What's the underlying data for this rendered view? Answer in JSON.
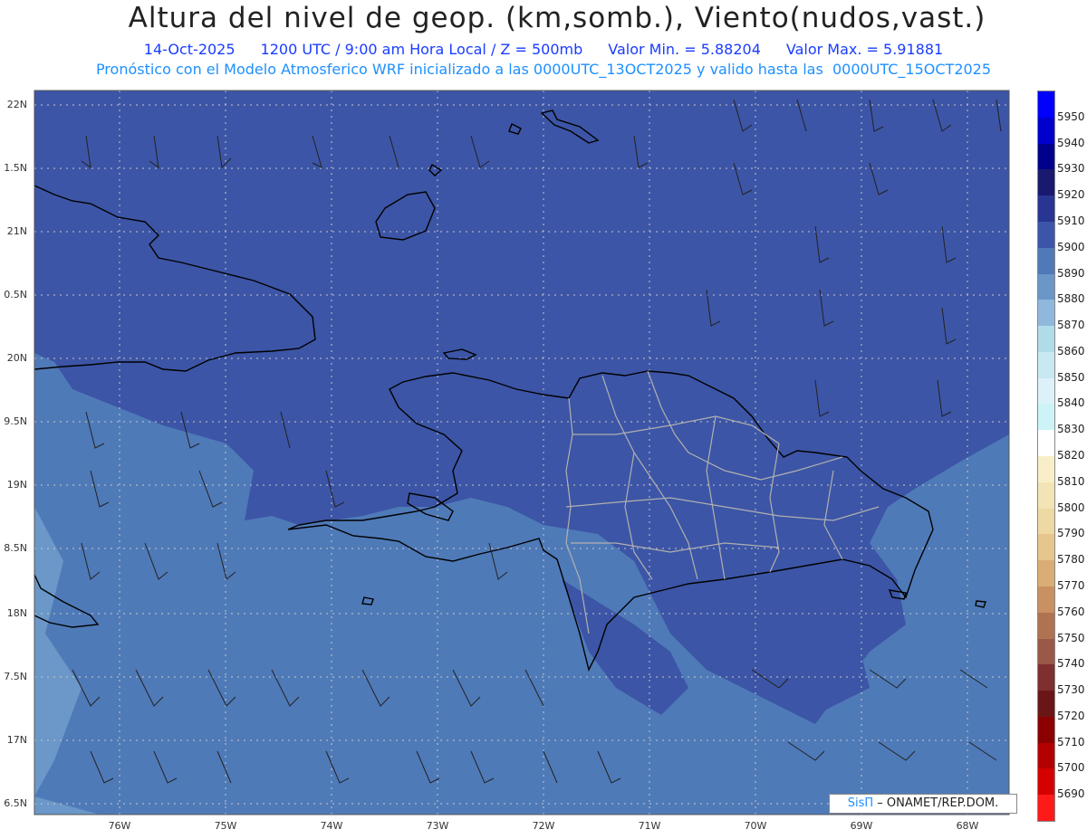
{
  "header": {
    "title": "Altura del nivel de geop. (km,somb.), Viento(nudos,vast.)",
    "date": "14-Oct-2025",
    "time": "1200 UTC / 9:00 am Hora Local / Z = 500mb",
    "min": "Valor Min. = 5.88204",
    "max": "Valor Max. = 5.91881",
    "forecast": "Pronóstico con el Modelo Atmosferico WRF inicializado a las 0000UTC_13OCT2025 y valido hasta las  0000UTC_15OCT2025"
  },
  "lat_labels": [
    "22N",
    "1.5N",
    "21N",
    "0.5N",
    "20N",
    "9.5N",
    "19N",
    "8.5N",
    "18N",
    "7.5N",
    "17N",
    "6.5N"
  ],
  "lon_labels": [
    "76W",
    "75W",
    "74W",
    "73W",
    "72W",
    "71W",
    "70W",
    "69W",
    "68W"
  ],
  "colorbar": {
    "labels": [
      "5950",
      "5940",
      "5930",
      "5920",
      "5910",
      "5900",
      "5890",
      "5880",
      "5870",
      "5860",
      "5850",
      "5840",
      "5830",
      "5820",
      "5810",
      "5800",
      "5790",
      "5780",
      "5770",
      "5760",
      "5750",
      "5740",
      "5730",
      "5720",
      "5710",
      "5700",
      "5690"
    ],
    "colors": [
      "#0000ff",
      "#0000cd",
      "#00008b",
      "#191970",
      "#283593",
      "#3d55a8",
      "#5079b8",
      "#6b96c8",
      "#8fb8dc",
      "#b0dcea",
      "#c8e9f2",
      "#dcf2f8",
      "#ccf4f7",
      "#ffffff",
      "#f8efc8",
      "#f3e4b6",
      "#eed9a3",
      "#e6c68d",
      "#d9ad75",
      "#c99062",
      "#b07352",
      "#9a5847",
      "#7e2f2f",
      "#6b1616",
      "#8b0000",
      "#b30000",
      "#d50000",
      "#ff1a1a"
    ]
  },
  "credit": {
    "brand": "SisΠ",
    "text": " – ONAMET/REP.DOM."
  },
  "colors": {
    "deep": "#3c55a6",
    "mid": "#4f7ab8",
    "light": "#6b98c8",
    "land": "#000000",
    "province": "#b0b0b0"
  }
}
